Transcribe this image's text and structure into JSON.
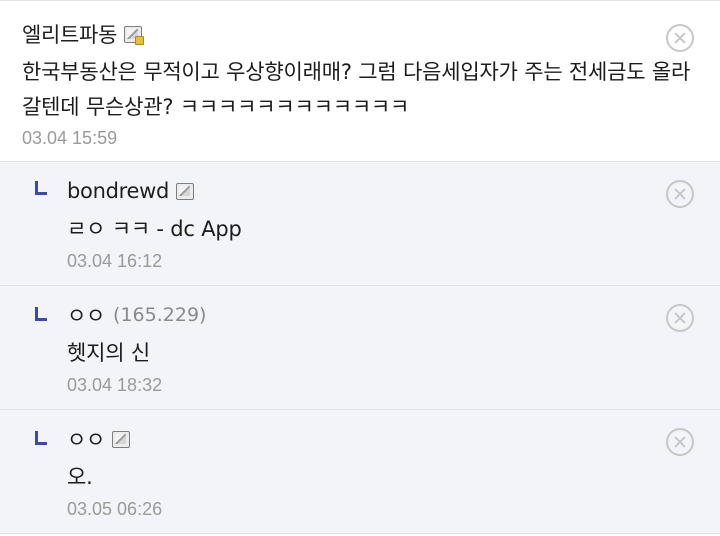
{
  "comments": [
    {
      "nick": "엘리트파동",
      "ip": "",
      "text": "한국부동산은 무적이고 우상향이래매? 그럼 다음세입자가 주는 전세금도 올라갈텐데 무슨상관? ㅋㅋㅋㅋㅋㅋㅋㅋㅋㅋㅋㅋ",
      "date": "03.04 15:59",
      "badge_icon": "half-fixed-nick-icon"
    }
  ],
  "replies": [
    {
      "nick": "bondrewd",
      "ip": "",
      "text": "ㄹㅇ ㅋㅋ - dc App",
      "date": "03.04 16:12",
      "badge_icon": "fixed-nick-icon"
    },
    {
      "nick": "ㅇㅇ",
      "ip": "(165.229)",
      "text": "헷지의 신",
      "date": "03.04 18:32",
      "badge_icon": ""
    },
    {
      "nick": "ㅇㅇ",
      "ip": "",
      "text": "오.",
      "date": "03.05 06:26",
      "badge_icon": "fixed-nick-icon"
    }
  ],
  "icons": {
    "reply": "reply-arrow-icon",
    "delete": "delete-circle-x-icon"
  },
  "colors": {
    "reply_bg": "#f3f4f9",
    "reply_arrow": "#3d4aa0",
    "date_text": "#9a9a9a",
    "divider": "#dfe1ea"
  }
}
